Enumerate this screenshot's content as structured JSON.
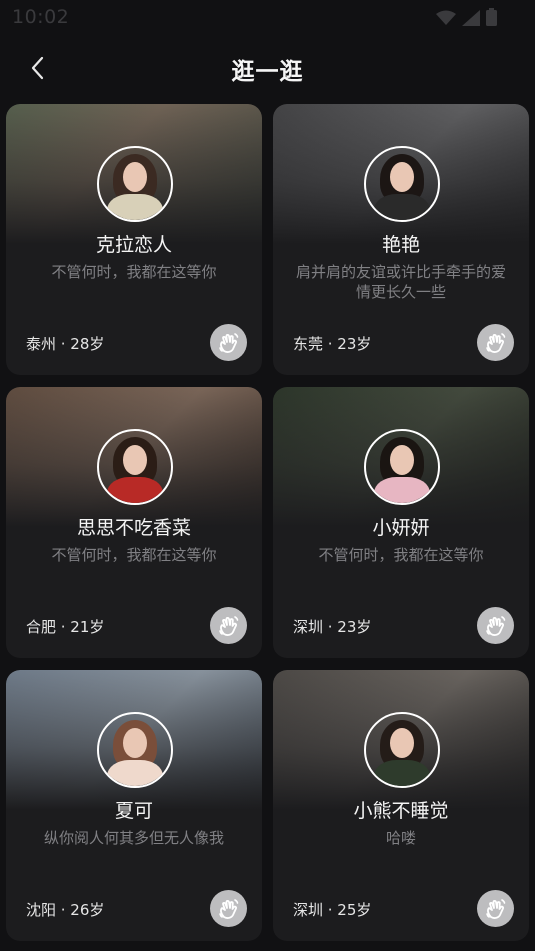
{
  "status_bar": {
    "time": "10:02",
    "icons": [
      "wifi-icon",
      "signal-icon",
      "battery-icon"
    ]
  },
  "header": {
    "back_icon": "chevron-left-icon",
    "title": "逛一逛"
  },
  "colors": {
    "background": "#111113",
    "card": "#1c1c1e",
    "bio_text": "#808084",
    "wave_button": "#bdbdbf"
  },
  "cards": [
    {
      "name": "克拉恋人",
      "bio": "不管何时，我都在这等你",
      "location": "泰州",
      "age": "28岁",
      "meta": "泰州 · 28岁",
      "action_icon": "wave-hand-icon",
      "bg": "linear-gradient(135deg,#5f6a55 0%,#7e6f5f 40%,#4a4f44 100%)",
      "hair": "#3b2a22",
      "body": "#d8d0b8"
    },
    {
      "name": "艳艳",
      "bio": "肩并肩的友谊或许比手牵手的爱情更长久一些",
      "location": "东莞",
      "age": "23岁",
      "meta": "东莞 · 23岁",
      "action_icon": "wave-hand-icon",
      "bg": "linear-gradient(135deg,#4a4a4c 0%,#6b6b6d 50%,#3a3a3c 100%)",
      "hair": "#1c1614",
      "body": "#2a2a2a"
    },
    {
      "name": "思思不吃香菜",
      "bio": "不管何时，我都在这等你",
      "location": "合肥",
      "age": "21岁",
      "meta": "合肥 · 21岁",
      "action_icon": "wave-hand-icon",
      "bg": "linear-gradient(135deg,#6a5445 0%,#8a7262 50%,#4c3c32 100%)",
      "hair": "#2b1d16",
      "body": "#b82a26"
    },
    {
      "name": "小妍妍",
      "bio": "不管何时，我都在这等你",
      "location": "深圳",
      "age": "23岁",
      "meta": "深圳 · 23岁",
      "action_icon": "wave-hand-icon",
      "bg": "linear-gradient(135deg,#2f3a2c 0%,#4a5243 50%,#262a22 100%)",
      "hair": "#1a1512",
      "body": "#e7b6c2"
    },
    {
      "name": "夏可",
      "bio": "纵你阅人何其多但无人像我",
      "location": "沈阳",
      "age": "26岁",
      "meta": "沈阳 · 26岁",
      "action_icon": "wave-hand-icon",
      "bg": "linear-gradient(135deg,#7c8a9a 0%,#9aa6b2 50%,#5b6570 100%)",
      "hair": "#7a4e3a",
      "body": "#efd9cc"
    },
    {
      "name": "小熊不睡觉",
      "bio": "哈喽",
      "location": "深圳",
      "age": "25岁",
      "meta": "深圳 · 25岁",
      "action_icon": "wave-hand-icon",
      "bg": "linear-gradient(135deg,#54504c 0%,#76706a 50%,#3a3734 100%)",
      "hair": "#241c18",
      "body": "#2e3b2c"
    }
  ]
}
